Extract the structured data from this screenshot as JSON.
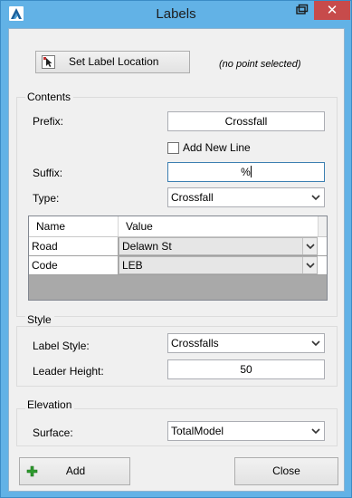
{
  "window": {
    "title": "Labels"
  },
  "toolbar": {
    "set_label_location": "Set Label Location",
    "selection_status": "(no point selected)"
  },
  "contents": {
    "group_label": "Contents",
    "prefix_label": "Prefix:",
    "prefix_value": "Crossfall",
    "add_new_line_label": "Add New Line",
    "add_new_line_checked": false,
    "suffix_label": "Suffix:",
    "suffix_value": "%",
    "type_label": "Type:",
    "type_value": "Crossfall",
    "grid": {
      "columns": [
        "Name",
        "Value"
      ],
      "rows": [
        {
          "name": "Road",
          "value": "Delawn St"
        },
        {
          "name": "Code",
          "value": "LEB"
        }
      ]
    }
  },
  "style": {
    "group_label": "Style",
    "label_style_label": "Label Style:",
    "label_style_value": "Crossfalls",
    "leader_height_label": "Leader Height:",
    "leader_height_value": "50"
  },
  "elevation": {
    "group_label": "Elevation",
    "surface_label": "Surface:",
    "surface_value": "TotalModel"
  },
  "footer": {
    "add_label": "Add",
    "close_label": "Close"
  },
  "colors": {
    "title_bar": "#62b2e6",
    "close_button": "#c74b4b",
    "add_icon": "#2e9b2e"
  }
}
